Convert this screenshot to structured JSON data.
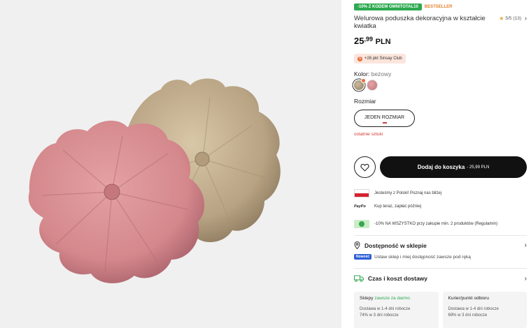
{
  "product": {
    "badge_promo": "-10% Z KODEM OMNITOTAL10",
    "badge_bestseller": "BESTSELLER",
    "title": "Welurowa poduszka dekoracyjna w kształcie kwiatka",
    "rating_value": "5/5",
    "rating_count": "(13)",
    "price_main": "25",
    "price_decimal": ",99",
    "price_currency": "PLN",
    "club_points": "+26 pkt Sinsay Club",
    "color_label": "Kolor:",
    "color_value": "beżowy",
    "swatches": [
      "beżowy",
      "różowy"
    ],
    "size_label": "Rozmiar",
    "size_button": "JEDEN ROZMIAR",
    "stock_note": "ostatnie sztuki",
    "add_to_cart_label": "Dodaj do koszyka",
    "add_to_cart_price": " - 25,99 PLN"
  },
  "info": {
    "poland": "Jesteśmy z Polski! Poznaj nas bliżej",
    "paypo_logo": "PayPo",
    "paypo": "Kup teraz, zapłać później",
    "promo": "-10% NA WSZYSTKO przy zakupie min. 2 produktów (Regulamin)"
  },
  "availability": {
    "title": "Dostępność w sklepie",
    "new_badge": "Nowość",
    "text": "Ustaw sklep i miej dostępność zawsze pod ręką"
  },
  "delivery": {
    "title": "Czas i koszt dostawy",
    "stores": {
      "heading": "Sklepy",
      "highlight": "zawsze za darmo",
      "line1": "Dostawa w 1-4 dni robocze",
      "line2": "74% w 3 dni robocze"
    },
    "courier": {
      "heading": "Kurier/punkt odbioru",
      "line1": "Dostawa w 1-4 dni robocze",
      "line2": "69% w 3 dni robocze"
    }
  },
  "colors": {
    "accent_dark": "#111111",
    "promo_green": "#2da94f",
    "bestseller_orange": "#e3822c",
    "stock_red": "#d23a3a",
    "new_blue": "#2d5fd6"
  },
  "icons": [
    "star-icon",
    "chevron-right-icon",
    "heart-icon",
    "poland-flag-icon",
    "paypo-logo-icon",
    "promo-tag-icon",
    "location-pin-icon",
    "truck-icon"
  ]
}
